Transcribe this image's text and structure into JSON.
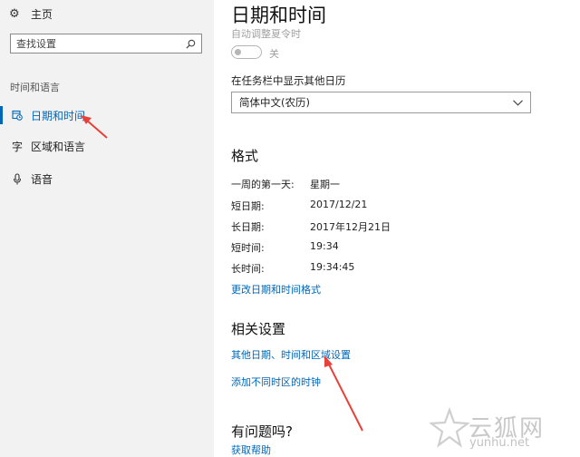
{
  "sidebar": {
    "home_label": "主页",
    "search_placeholder": "查找设置",
    "section_title": "时间和语言",
    "items": [
      {
        "label": "日期和时间",
        "icon": "calendar-clock-icon",
        "active": true
      },
      {
        "label": "区域和语言",
        "icon": "language-icon",
        "active": false
      },
      {
        "label": "语音",
        "icon": "microphone-icon",
        "active": false
      }
    ]
  },
  "main": {
    "title": "日期和时间",
    "dst_label": "自动调整夏令时",
    "dst_state": "关",
    "calendar_label": "在任务栏中显示其他日历",
    "calendar_value": "简体中文(农历)",
    "format_heading": "格式",
    "formats": [
      {
        "key": "一周的第一天:",
        "value": "星期一"
      },
      {
        "key": "短日期:",
        "value": "2017/12/21"
      },
      {
        "key": "长日期:",
        "value": "2017年12月21日"
      },
      {
        "key": "短时间:",
        "value": "19:34"
      },
      {
        "key": "长时间:",
        "value": "19:34:45"
      }
    ],
    "change_format_link": "更改日期和时间格式",
    "related_heading": "相关设置",
    "related_links": [
      "其他日期、时间和区域设置",
      "添加不同时区的时钟"
    ],
    "question_heading": "有问题吗?",
    "help_link": "获取帮助"
  },
  "watermark": {
    "cn": "云狐网",
    "en": "yunhu.net"
  },
  "colors": {
    "accent": "#0067b8",
    "arrow": "#e8413a",
    "sidebar_bg": "#f2f2f2"
  }
}
